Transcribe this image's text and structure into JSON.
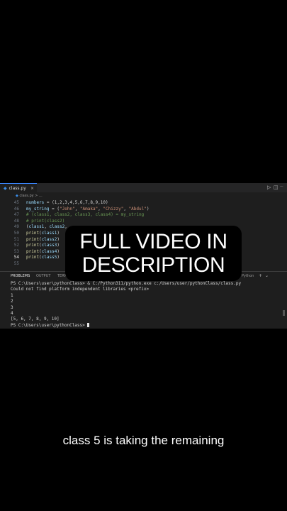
{
  "editor": {
    "tab_label": "class.py",
    "tab_close": "×",
    "breadcrumb": "class.py > ...",
    "run_icon": "▷",
    "split_icon": "◫",
    "more_icon": "···",
    "lines": [
      {
        "n": "45",
        "segs": [
          {
            "c": "var",
            "t": "numbers"
          },
          {
            "c": "op",
            "t": " = (1,2,3,4,5,6,7,8,9,10)"
          }
        ]
      },
      {
        "n": "46",
        "segs": [
          {
            "c": "var",
            "t": "my_string"
          },
          {
            "c": "op",
            "t": " = ("
          },
          {
            "c": "str",
            "t": "\"John\""
          },
          {
            "c": "op",
            "t": ", "
          },
          {
            "c": "str",
            "t": "\"Amaka\""
          },
          {
            "c": "op",
            "t": ", "
          },
          {
            "c": "str",
            "t": "\"Chizzy\""
          },
          {
            "c": "op",
            "t": ", "
          },
          {
            "c": "str",
            "t": "\"Abdul\""
          },
          {
            "c": "op",
            "t": ")"
          }
        ]
      },
      {
        "n": "47",
        "segs": [
          {
            "c": "cmt",
            "t": "# (class1, class2, class3, class4) = my_string"
          }
        ]
      },
      {
        "n": "48",
        "segs": [
          {
            "c": "cmt",
            "t": "# print(class2)"
          }
        ]
      },
      {
        "n": "49",
        "segs": [
          {
            "c": "op",
            "t": "("
          },
          {
            "c": "var",
            "t": "class1"
          },
          {
            "c": "op",
            "t": ", "
          },
          {
            "c": "var",
            "t": "class2"
          },
          {
            "c": "op",
            "t": ","
          }
        ]
      },
      {
        "n": "50",
        "segs": [
          {
            "c": "fn",
            "t": "print"
          },
          {
            "c": "op",
            "t": "("
          },
          {
            "c": "var",
            "t": "class1"
          },
          {
            "c": "op",
            "t": ")"
          }
        ]
      },
      {
        "n": "51",
        "segs": [
          {
            "c": "fn",
            "t": "print"
          },
          {
            "c": "op",
            "t": "("
          },
          {
            "c": "var",
            "t": "class2"
          },
          {
            "c": "op",
            "t": ")"
          }
        ]
      },
      {
        "n": "52",
        "segs": [
          {
            "c": "fn",
            "t": "print"
          },
          {
            "c": "op",
            "t": "("
          },
          {
            "c": "var",
            "t": "class3"
          },
          {
            "c": "op",
            "t": ")"
          }
        ]
      },
      {
        "n": "53",
        "segs": [
          {
            "c": "fn",
            "t": "print"
          },
          {
            "c": "op",
            "t": "("
          },
          {
            "c": "var",
            "t": "class4"
          },
          {
            "c": "op",
            "t": ")"
          }
        ]
      },
      {
        "n": "54",
        "segs": [
          {
            "c": "fn",
            "t": "print"
          },
          {
            "c": "op",
            "t": "("
          },
          {
            "c": "var",
            "t": "class5"
          },
          {
            "c": "op",
            "t": ")"
          }
        ],
        "current": true
      },
      {
        "n": "55",
        "segs": []
      }
    ]
  },
  "panel": {
    "tabs": [
      "PROBLEMS",
      "OUTPUT",
      "TERM"
    ],
    "active_tab": "PROBLEMS",
    "shell_label": "Python",
    "add_icon": "+",
    "dropdown_icon": "⌄",
    "terminal_lines": [
      "PS C:\\Users\\user\\pythonClass> & C:/Python311/python.exe c:/Users/user/pythonClass/class.py",
      "Could not find platform independent libraries <prefix>",
      "1",
      "2",
      "3",
      "4",
      "[5, 6, 7, 8, 9, 10]"
    ],
    "prompt": "PS C:\\Users\\user\\pythonClass> "
  },
  "overlay": {
    "line1": "FULL VIDEO IN",
    "line2": "DESCRIPTION"
  },
  "caption": "class 5 is taking the remaining",
  "colors": {
    "background": "#000000",
    "editor_bg": "#1e1e1e",
    "accent": "#3a86ff"
  }
}
